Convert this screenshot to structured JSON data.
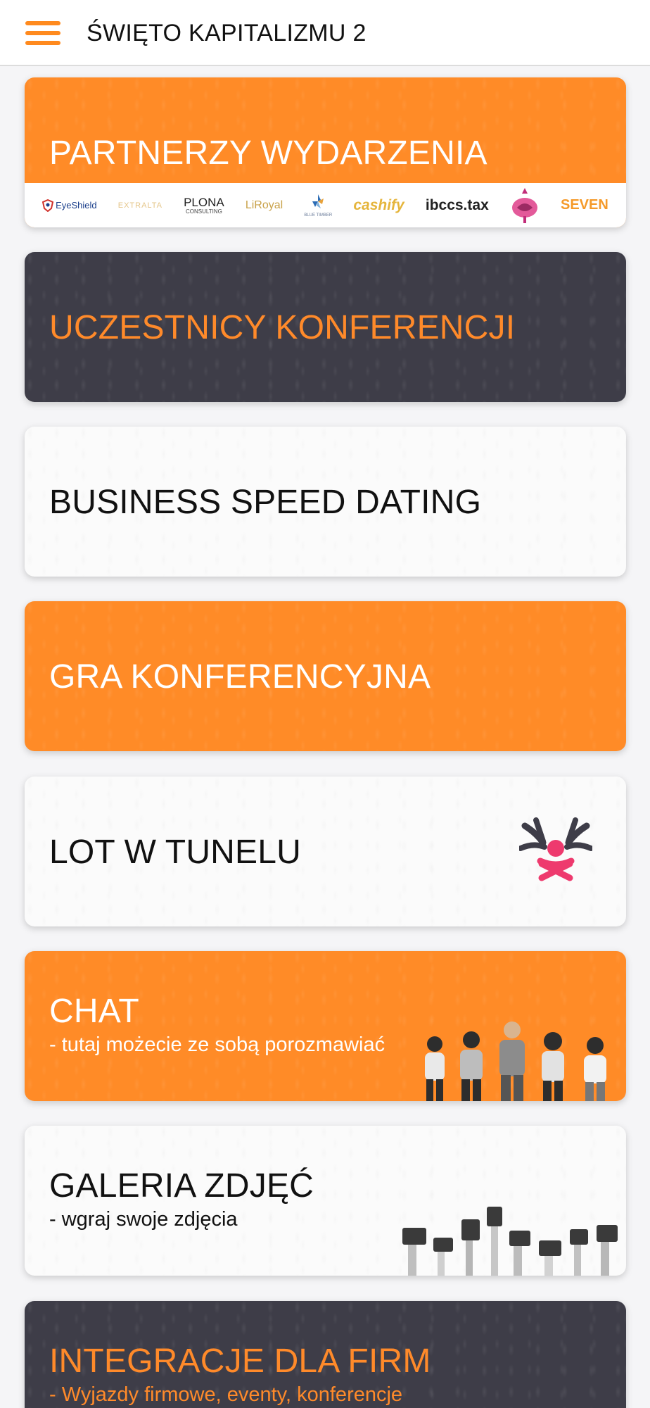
{
  "header": {
    "title": "ŚWIĘTO KAPITALIZMU 2",
    "menu_icon": "hamburger-icon",
    "accent_color": "#ff8a1e"
  },
  "cards": [
    {
      "title": "PARTNERZY WYDARZENIA",
      "color": "#ff8b27",
      "partners": [
        "EyeShield",
        "EXTRALTA",
        "PLONA",
        "CONSULTING",
        "LiRoyal",
        "BLUE TIMBER",
        "cashify",
        "ibccs.tax",
        "SEVEN"
      ]
    },
    {
      "title": "UCZESTNICY KONFERENCJI",
      "color": "#3e3d48"
    },
    {
      "title": "BUSINESS SPEED DATING",
      "color": "#fbfbfb"
    },
    {
      "title": "GRA KONFERENCYJNA",
      "color": "#ff8b27"
    },
    {
      "title": "LOT W TUNELU",
      "color": "#fbfbfb",
      "icon": "tunnel-flyer-icon"
    },
    {
      "title": "CHAT",
      "subtitle": "- tutaj możecie ze sobą porozmawiać",
      "color": "#ff8b27",
      "image": "people-with-phones"
    },
    {
      "title": "GALERIA ZDJĘĆ",
      "subtitle": "- wgraj swoje zdjęcia",
      "color": "#fbfbfb",
      "image": "hands-with-cameras"
    },
    {
      "title": "INTEGRACJE DLA FIRM",
      "subtitle": "- Wyjazdy firmowe, eventy, konferencje",
      "color": "#3e3d48"
    }
  ]
}
